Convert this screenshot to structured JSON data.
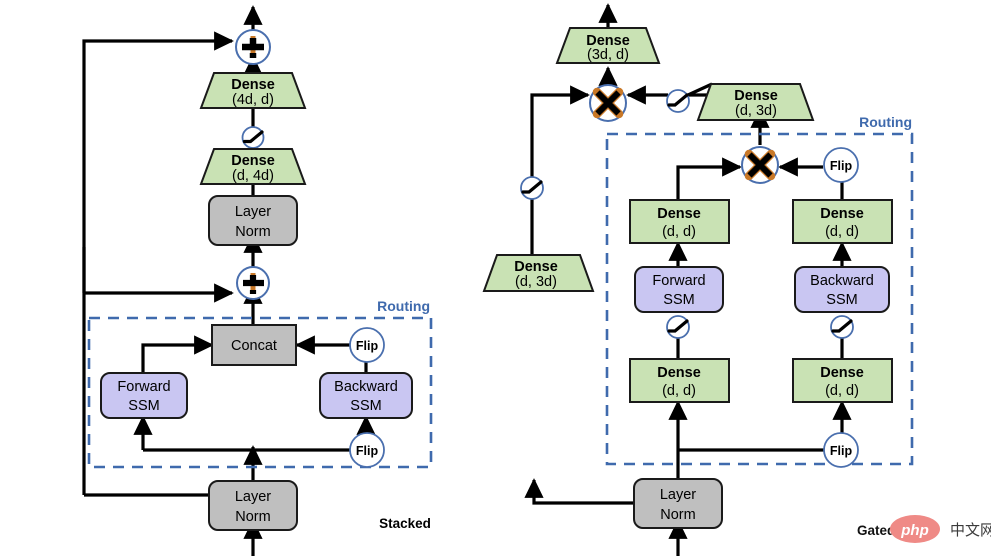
{
  "figure": {
    "title_left": "Stacked",
    "title_right": "Gated",
    "routing_label": "Routing"
  },
  "colors": {
    "dense_fill": "#c9e2b4",
    "dense_stroke": "#1a1a1a",
    "norm_fill": "#bfbfbf",
    "norm_stroke": "#1a1a1a",
    "ssm_fill": "#c9c6f2",
    "ssm_stroke": "#1a1a1a",
    "concat_fill": "#bfbfbf",
    "routing_dash": "#3f6aad",
    "routing_text": "#3f6aad",
    "op_circle_stroke": "#4a6fae",
    "arrow": "#000000",
    "watermark_php": "#ef8a86",
    "background": "#ffffff"
  },
  "left_panel": {
    "caption": "Stacked",
    "routing_label": "Routing",
    "nodes": [
      {
        "id": "add-top",
        "kind": "op-plus",
        "label": "+"
      },
      {
        "id": "dense-4d-d",
        "kind": "trapezoid",
        "title": "Dense",
        "subtitle": "(4d, d)"
      },
      {
        "id": "act-ffn",
        "kind": "activation",
        "label": "activation"
      },
      {
        "id": "dense-d-4d",
        "kind": "trapezoid",
        "title": "Dense",
        "subtitle": "(d, 4d)"
      },
      {
        "id": "layer-norm-top",
        "kind": "rounded",
        "line1": "Layer",
        "line2": "Norm"
      },
      {
        "id": "add-mid",
        "kind": "op-plus",
        "label": "+"
      },
      {
        "id": "concat",
        "kind": "rect",
        "label": "Concat"
      },
      {
        "id": "flip-top",
        "kind": "circle",
        "label": "Flip"
      },
      {
        "id": "forward-ssm",
        "kind": "rounded",
        "line1": "Forward",
        "line2": "SSM"
      },
      {
        "id": "backward-ssm",
        "kind": "rounded",
        "line1": "Backward",
        "line2": "SSM"
      },
      {
        "id": "flip-bottom",
        "kind": "circle",
        "label": "Flip"
      },
      {
        "id": "layer-norm-bot",
        "kind": "rounded",
        "line1": "Layer",
        "line2": "Norm"
      }
    ]
  },
  "right_panel": {
    "caption": "Gated",
    "routing_label": "Routing",
    "nodes": [
      {
        "id": "dense-3d-d",
        "kind": "trapezoid",
        "title": "Dense",
        "subtitle": "(3d, d)"
      },
      {
        "id": "mul-top",
        "kind": "op-times",
        "label": "×"
      },
      {
        "id": "act-gate",
        "kind": "activation",
        "label": "activation"
      },
      {
        "id": "dense-d-3d-right",
        "kind": "trapezoid",
        "title": "Dense",
        "subtitle": "(d, 3d)"
      },
      {
        "id": "act-left-gate",
        "kind": "activation",
        "label": "activation"
      },
      {
        "id": "dense-d-3d-left",
        "kind": "trapezoid",
        "title": "Dense",
        "subtitle": "(d, 3d)"
      },
      {
        "id": "mul-routing",
        "kind": "op-times",
        "label": "×"
      },
      {
        "id": "flip-upper",
        "kind": "circle",
        "label": "Flip"
      },
      {
        "id": "dense-dd-fwd-up",
        "kind": "rect",
        "title": "Dense",
        "subtitle": "(d, d)"
      },
      {
        "id": "dense-dd-bwd-up",
        "kind": "rect",
        "title": "Dense",
        "subtitle": "(d, d)"
      },
      {
        "id": "forward-ssm",
        "kind": "rounded",
        "line1": "Forward",
        "line2": "SSM"
      },
      {
        "id": "backward-ssm",
        "kind": "rounded",
        "line1": "Backward",
        "line2": "SSM"
      },
      {
        "id": "act-fwd",
        "kind": "activation",
        "label": "activation"
      },
      {
        "id": "act-bwd",
        "kind": "activation",
        "label": "activation"
      },
      {
        "id": "dense-dd-fwd-lo",
        "kind": "rect",
        "title": "Dense",
        "subtitle": "(d, d)"
      },
      {
        "id": "dense-dd-bwd-lo",
        "kind": "rect",
        "title": "Dense",
        "subtitle": "(d, d)"
      },
      {
        "id": "flip-lower",
        "kind": "circle",
        "label": "Flip"
      },
      {
        "id": "layer-norm",
        "kind": "rounded",
        "line1": "Layer",
        "line2": "Norm"
      }
    ]
  },
  "text": {
    "dense": "Dense",
    "dim_4d_d": "(4d, d)",
    "dim_d_4d": "(d, 4d)",
    "dim_3d_d": "(3d, d)",
    "dim_d_3d": "(d, 3d)",
    "dim_d_d": "(d, d)",
    "layer": "Layer",
    "norm": "Norm",
    "concat": "Concat",
    "flip": "Flip",
    "forward": "Forward",
    "backward": "Backward",
    "ssm": "SSM"
  },
  "watermark": {
    "prefix": "Gated",
    "badge": "php",
    "suffix": "中文网"
  }
}
